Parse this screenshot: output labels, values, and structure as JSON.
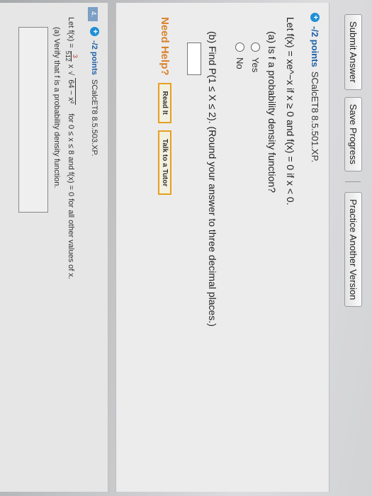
{
  "toolbar": {
    "submit_label": "Submit Answer",
    "save_label": "Save Progress",
    "practice_label": "Practice Another Version"
  },
  "q3": {
    "points": "-/2 points",
    "code": "SCalcET8 8.5.501.XP.",
    "function_text": "Let f(x) = xe^−x if x ≥ 0 and f(x) = 0 if x < 0.",
    "part_a": "(a) Is f a probability density function?",
    "option_yes": "Yes",
    "option_no": "No",
    "part_b": "(b) Find P(1 ≤ X ≤ 2). (Round your answer to three decimal places.)",
    "part_b_value": ""
  },
  "help": {
    "label": "Need Help?",
    "read_it": "Read It",
    "talk_tutor": "Talk to a Tutor"
  },
  "q4": {
    "number": "4.",
    "points": "-/2 points",
    "code": "SCalcET8 8.5.503.XP.",
    "let": "Let f(x) =",
    "frac_num": "3",
    "frac_den": "512",
    "expr": "x",
    "radicand": "64 − x²",
    "condition": "for 0 ≤ x ≤ 8 and f(x) = 0 for all other values of x.",
    "part_a": "(a) Verify that f is a probability density function."
  },
  "colors": {
    "points_blue": "#1d5fa6",
    "help_orange": "#d9822b"
  }
}
